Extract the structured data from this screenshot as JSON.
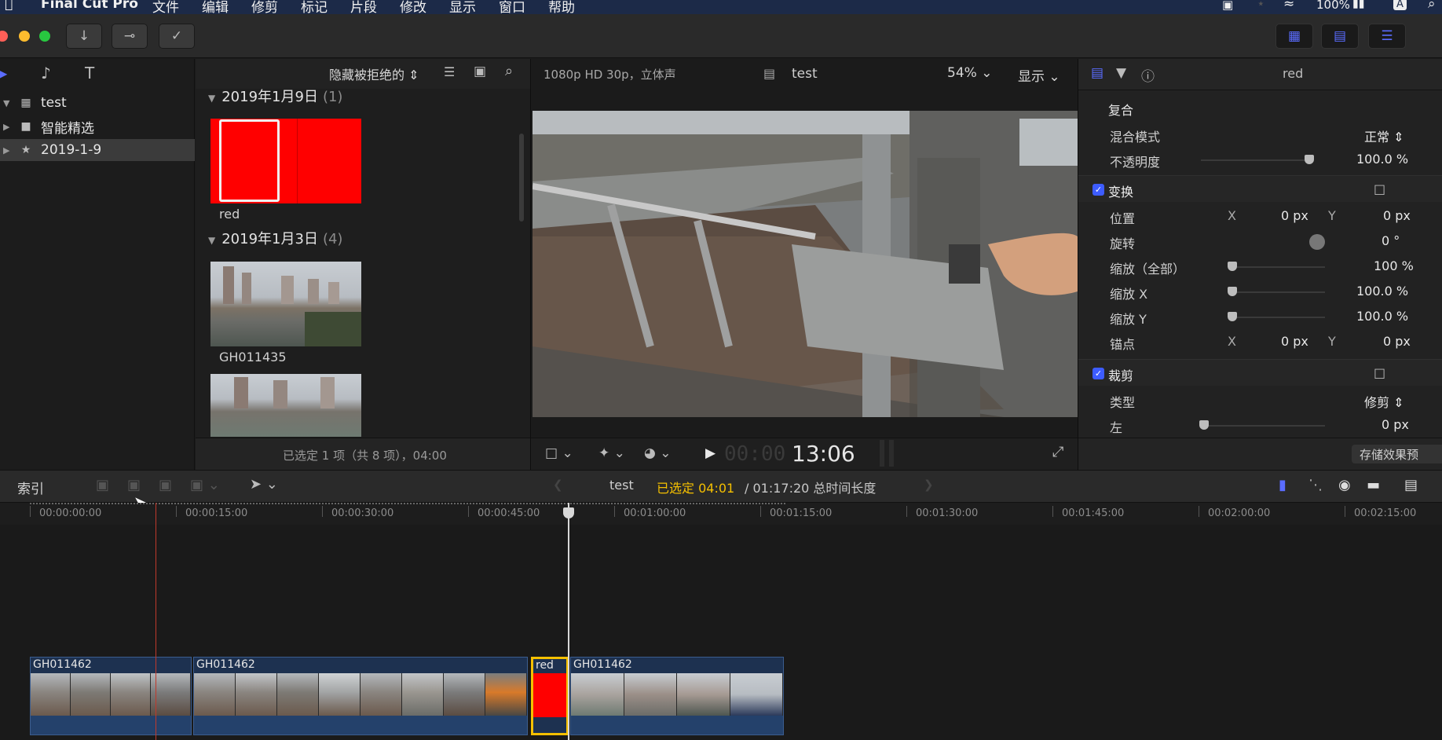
{
  "menubar": {
    "apple": "",
    "app": "Final Cut Pro",
    "items": [
      "文件",
      "编辑",
      "修剪",
      "标记",
      "片段",
      "修改",
      "显示",
      "窗口",
      "帮助"
    ],
    "battery": "100%",
    "input_method": "A"
  },
  "sidebar": {
    "items": [
      {
        "label": "test",
        "icon": "library-icon"
      },
      {
        "label": "智能精选",
        "icon": "folder-icon"
      },
      {
        "label": "2019-1-9",
        "icon": "event-star-icon"
      }
    ]
  },
  "browser": {
    "filter": "隐藏被拒绝的",
    "groups": [
      {
        "date": "2019年1月9日",
        "count": "(1)",
        "clips": [
          "red"
        ]
      },
      {
        "date": "2019年1月3日",
        "count": "(4)",
        "clips": [
          "GH011435"
        ]
      }
    ],
    "status": "已选定 1 项（共 8 项），04:00"
  },
  "viewer": {
    "format": "1080p HD 30p，立体声",
    "project": "test",
    "zoom": "54%",
    "display": "显示",
    "timecode_dim": "00:00",
    "timecode": "13:06"
  },
  "inspector": {
    "title": "red",
    "composite": "复合",
    "blend_mode_label": "混合模式",
    "blend_mode_value": "正常",
    "opacity_label": "不透明度",
    "opacity_value": "100.0 %",
    "opacity_level": 1.0,
    "transform": "变换",
    "position_label": "位置",
    "position_x_label": "X",
    "position_x": "0 px",
    "position_y_label": "Y",
    "position_y": "0 px",
    "rotation_label": "旋转",
    "rotation_value": "0 °",
    "scale_all_label": "缩放（全部）",
    "scale_all_value": "100 %",
    "scale_x_label": "缩放 X",
    "scale_x_value": "100.0 %",
    "scale_y_label": "缩放 Y",
    "scale_y_value": "100.0 %",
    "anchor_label": "锚点",
    "anchor_x_label": "X",
    "anchor_x": "0 px",
    "anchor_y_label": "Y",
    "anchor_y": "0 px",
    "crop": "裁剪",
    "crop_type_label": "类型",
    "crop_type_value": "修剪",
    "crop_left_label": "左",
    "crop_left_value": "0 px",
    "save_preset": "存储效果预"
  },
  "timeline_bar": {
    "index": "索引",
    "project": "test",
    "selected": "已选定 04:01",
    "duration": "/ 01:17:20 总时间长度"
  },
  "ruler": [
    "00:00:00:00",
    "00:00:15:00",
    "00:00:30:00",
    "00:00:45:00",
    "00:01:00:00",
    "00:01:15:00",
    "00:01:30:00",
    "00:01:45:00",
    "00:02:00:00",
    "00:02:15:00"
  ],
  "clips": [
    {
      "name": "GH011462"
    },
    {
      "name": "GH011462"
    },
    {
      "name": "red"
    },
    {
      "name": "GH011462"
    }
  ],
  "colors": {
    "accent": "#3d5cff",
    "selection": "#f5c000",
    "red_clip": "#ff0000",
    "clip_blue": "#1d3150"
  }
}
